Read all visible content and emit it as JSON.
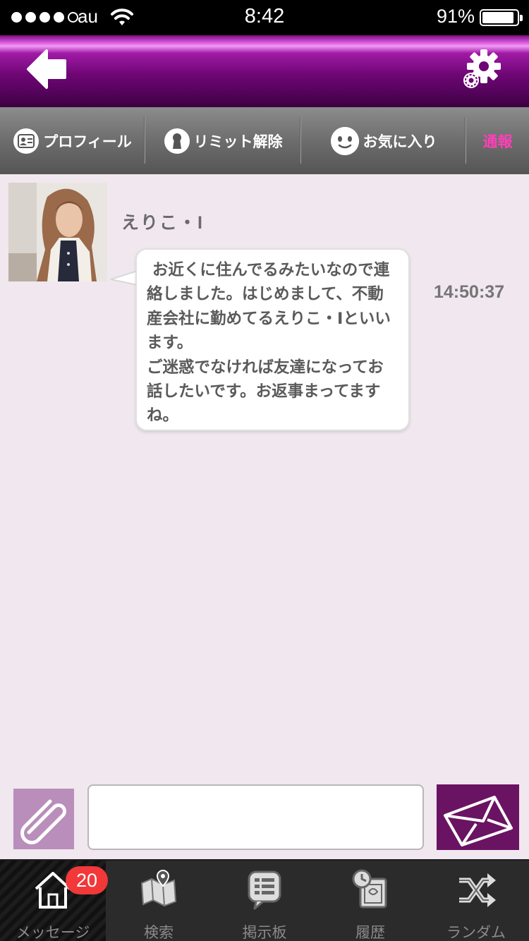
{
  "status_bar": {
    "carrier": "au",
    "time": "8:42",
    "battery_percent": "91%",
    "battery_level": 0.91,
    "signal_bars": 4,
    "signal_max": 5
  },
  "header": {
    "back_icon": "back-arrow-icon",
    "settings_icon": "gear-icon"
  },
  "toolbar": {
    "items": [
      {
        "label": "プロフィール",
        "icon": "profile-card-icon"
      },
      {
        "label": "リミット解除",
        "icon": "keyhole-icon"
      },
      {
        "label": "お気に入り",
        "icon": "smiley-icon"
      },
      {
        "label": "通報"
      }
    ]
  },
  "conversation": {
    "sender_name": "えりこ・I",
    "message_text": " お近くに住んでるみたいなので連絡しました。はじめまして、不動産会社に勤めてるえりこ・Iといいます。\nご迷惑でなければ友達になってお話したいです。お返事まってますね。",
    "timestamp": "14:50:37"
  },
  "composer": {
    "input_value": "",
    "attach_icon": "paperclip-icon",
    "send_icon": "envelope-icon"
  },
  "bottom_nav": {
    "tabs": [
      {
        "label": "メッセージ",
        "icon": "house-icon",
        "badge": "20",
        "active": true
      },
      {
        "label": "検索",
        "icon": "map-pin-icon"
      },
      {
        "label": "掲示板",
        "icon": "board-icon"
      },
      {
        "label": "履歴",
        "icon": "history-icon"
      },
      {
        "label": "ランダム",
        "icon": "shuffle-icon"
      }
    ]
  },
  "colors": {
    "header_purple": "#6e0674",
    "report_pink": "#ff3fb8",
    "badge_red": "#f23838",
    "send_purple": "#6a1363",
    "attach_purple": "#b98ebb",
    "chat_background": "#f1e7ee"
  }
}
